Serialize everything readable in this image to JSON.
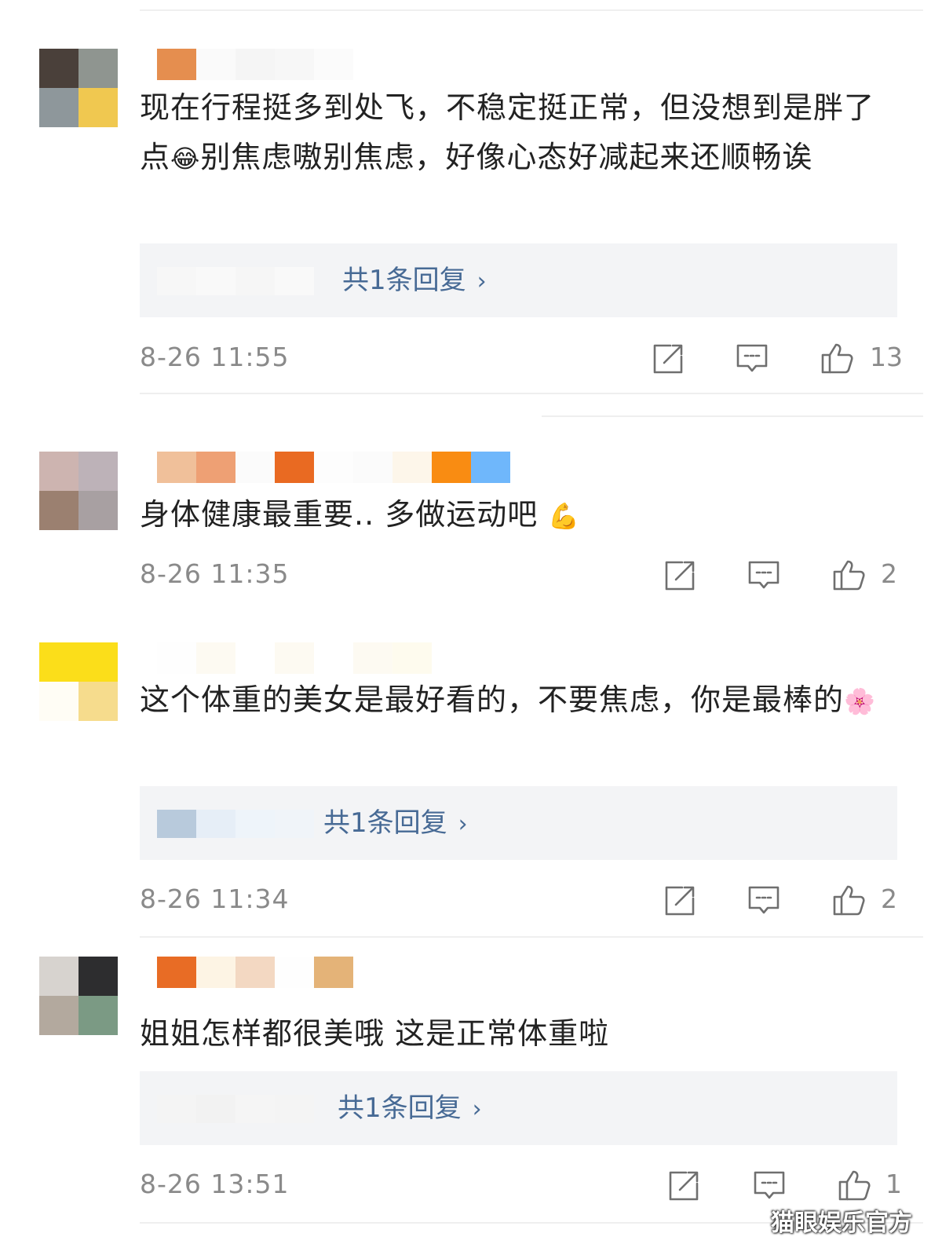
{
  "comments": [
    {
      "avatar_colors": [
        "#4a403a",
        "#8f9590",
        "#8e979b",
        "#f0c850"
      ],
      "name_blur_colors": [
        "#e58e4f",
        "#fafafa",
        "#f5f5f5",
        "#f7f7f7",
        "#fbfbfb",
        "#ffffff"
      ],
      "text": "现在行程挺多到处飞，不稳定挺正常，但没想到是胖了点",
      "emoji": "😂",
      "text_after": "别焦虑嗷别焦虑，好像心态好减起来还顺畅诶",
      "reply_label": "共1条回复",
      "reply_blur_colors": [
        "#f7f7f7",
        "#f9f9f9",
        "#f6f6f6",
        "#f9f9f9"
      ],
      "time": "8-26 11:55",
      "likes": "13"
    },
    {
      "avatar_colors": [
        "#cdb4b0",
        "#bdb2b8",
        "#9b8070",
        "#a8a0a2"
      ],
      "name_blur_colors": [
        "#f0c09a",
        "#eea074",
        "#fbfbfb",
        "#e96a22",
        "#fdfdfd",
        "#fbfbfb",
        "#fdf6ea",
        "#f98c12",
        "#6fb7fb"
      ],
      "text": "身体健康最重要.. 多做运动吧 ",
      "emoji": "💪",
      "text_after": "",
      "reply_label": "",
      "time": "8-26 11:35",
      "likes": "2"
    },
    {
      "avatar_colors": [
        "#fbde1a",
        "#fbde1a",
        "#fffdf5",
        "#f6dc8d"
      ],
      "name_blur_colors": [
        "#fefefe",
        "#fdfaf2",
        "#ffffff",
        "#fdfaf2",
        "#ffffff",
        "#fdfaf2",
        "#fefbee"
      ],
      "text": "这个体重的美女是最好看的，不要焦虑，你是最棒的",
      "emoji": "🌸",
      "text_after": "",
      "reply_label": "共1条回复",
      "reply_blur_colors": [
        "#b8cadc",
        "#e6eef7",
        "#eef4fa",
        "#f0f4f9"
      ],
      "time": "8-26 11:34",
      "likes": "2"
    },
    {
      "avatar_colors": [
        "#d7d3cf",
        "#2d2d2f",
        "#b3a99e",
        "#7b9a84"
      ],
      "name_blur_colors": [
        "#e86c25",
        "#fdf4e4",
        "#f3d8c2",
        "#fefefe",
        "#e4b378"
      ],
      "text": "姐姐怎样都很美哦 这是正常体重啦",
      "emoji": "",
      "text_after": "",
      "reply_label": "共1条回复",
      "reply_blur_colors": [
        "#f4f4f4",
        "#f2f2f2",
        "#f5f5f5",
        "#f4f4f4"
      ],
      "time": "8-26 13:51",
      "likes": "1"
    }
  ],
  "watermark": "猫眼娱乐官方"
}
